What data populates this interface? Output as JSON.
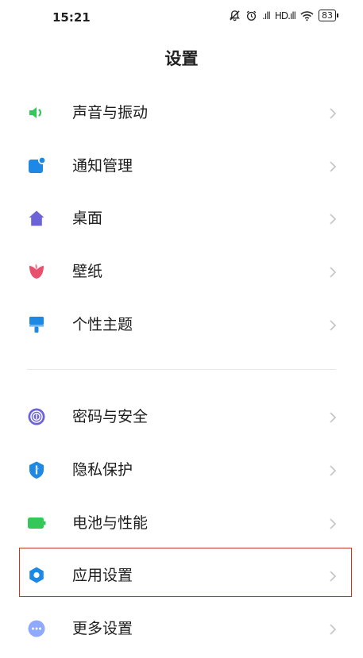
{
  "status_bar": {
    "time": "15:21",
    "signal1": ".ıll",
    "signal2": "HD.ıll",
    "battery": "83"
  },
  "header": {
    "title": "设置"
  },
  "group1": [
    {
      "label": "声音与振动",
      "icon": "speaker-icon",
      "color": "#34C759"
    },
    {
      "label": "通知管理",
      "icon": "notification-icon",
      "color": "#1E88E5"
    },
    {
      "label": "桌面",
      "icon": "home-icon",
      "color": "#6C63D9"
    },
    {
      "label": "壁纸",
      "icon": "tulip-icon",
      "color": "#E8506E"
    },
    {
      "label": "个性主题",
      "icon": "paintbrush-icon",
      "color": "#1E88E5"
    }
  ],
  "group2": [
    {
      "label": "密码与安全",
      "icon": "fingerprint-icon",
      "color": "#6C63D9"
    },
    {
      "label": "隐私保护",
      "icon": "shield-icon",
      "color": "#1E88E5"
    },
    {
      "label": "电池与性能",
      "icon": "battery-icon",
      "color": "#34C759"
    },
    {
      "label": "应用设置",
      "icon": "gear-icon",
      "color": "#1E88E5"
    },
    {
      "label": "更多设置",
      "icon": "more-icon",
      "color": "#7B9CFF"
    }
  ],
  "highlight_color": "#C0392B"
}
